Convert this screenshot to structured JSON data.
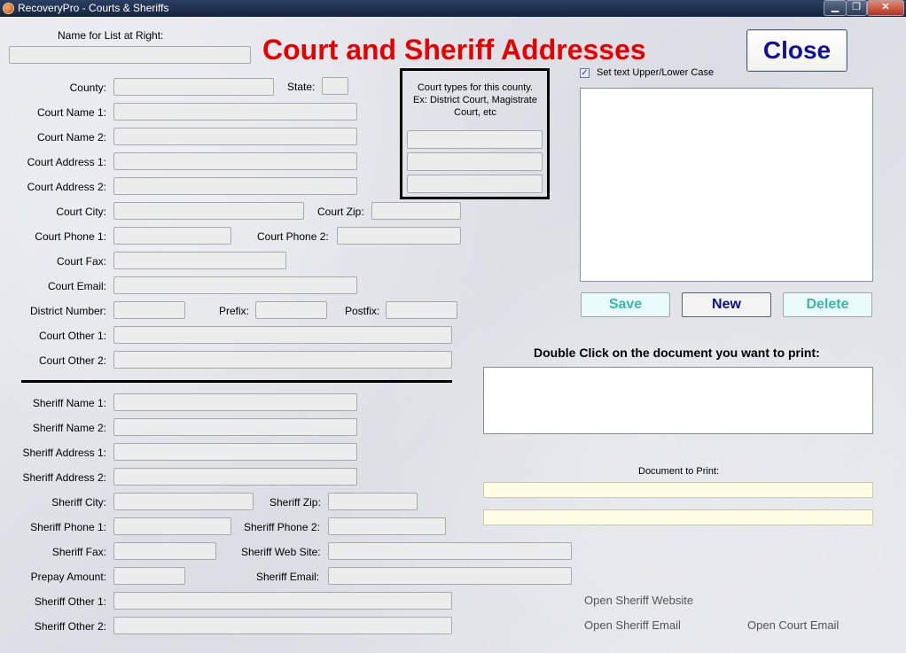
{
  "window": {
    "title": "RecoveryPro - Courts & Sheriffs",
    "minimize": "▁",
    "restore": "❐",
    "close": "✕"
  },
  "header": {
    "name_for_list_label": "Name for List at Right:",
    "name_for_list_value": "",
    "heading": "Court and Sheriff Addresses",
    "close_button": "Close"
  },
  "court": {
    "county_label": "County:",
    "state_label": "State:",
    "court_name_1_label": "Court Name 1:",
    "court_name_2_label": "Court Name 2:",
    "court_address_1_label": "Court Address 1:",
    "court_address_2_label": "Court Address 2:",
    "court_city_label": "Court City:",
    "court_zip_label": "Court Zip:",
    "court_phone_1_label": "Court Phone 1:",
    "court_phone_2_label": "Court Phone 2:",
    "court_fax_label": "Court Fax:",
    "court_email_label": "Court Email:",
    "district_number_label": "District Number:",
    "prefix_label": "Prefix:",
    "postfix_label": "Postfix:",
    "court_other_1_label": "Court Other 1:",
    "court_other_2_label": "Court Other 2:"
  },
  "court_types": {
    "note": "Court types for this county. Ex: District Court, Magistrate Court, etc"
  },
  "sheriff": {
    "sheriff_name_1_label": "Sheriff Name 1:",
    "sheriff_name_2_label": "Sheriff Name 2:",
    "sheriff_address_1_label": "Sheriff Address 1:",
    "sheriff_address_2_label": "Sheriff Address 2:",
    "sheriff_city_label": "Sheriff City:",
    "sheriff_zip_label": "Sheriff Zip:",
    "sheriff_phone_1_label": "Sheriff Phone 1:",
    "sheriff_phone_2_label": "Sheriff Phone 2:",
    "sheriff_fax_label": "Sheriff Fax:",
    "sheriff_web_site_label": "Sheriff Web Site:",
    "prepay_amount_label": "Prepay Amount:",
    "sheriff_email_label": "Sheriff Email:",
    "sheriff_other_1_label": "Sheriff Other 1:",
    "sheriff_other_2_label": "Sheriff Other 2:"
  },
  "right_panel": {
    "case_checkbox_label": "Set text Upper/Lower Case",
    "case_checkbox_checked": true,
    "save_button": "Save",
    "new_button": "New",
    "delete_button": "Delete",
    "print_instruction": "Double Click on the document you want to print:",
    "document_to_print_label": "Document to Print:",
    "open_sheriff_website": "Open Sheriff Website",
    "open_sheriff_email": "Open Sheriff Email",
    "open_court_email": "Open Court Email"
  },
  "colors": {
    "heading": "#e60000",
    "close_text": "#10129c",
    "teal_button_text": "#3cb7a8",
    "highlight_field": "#fffde4"
  }
}
